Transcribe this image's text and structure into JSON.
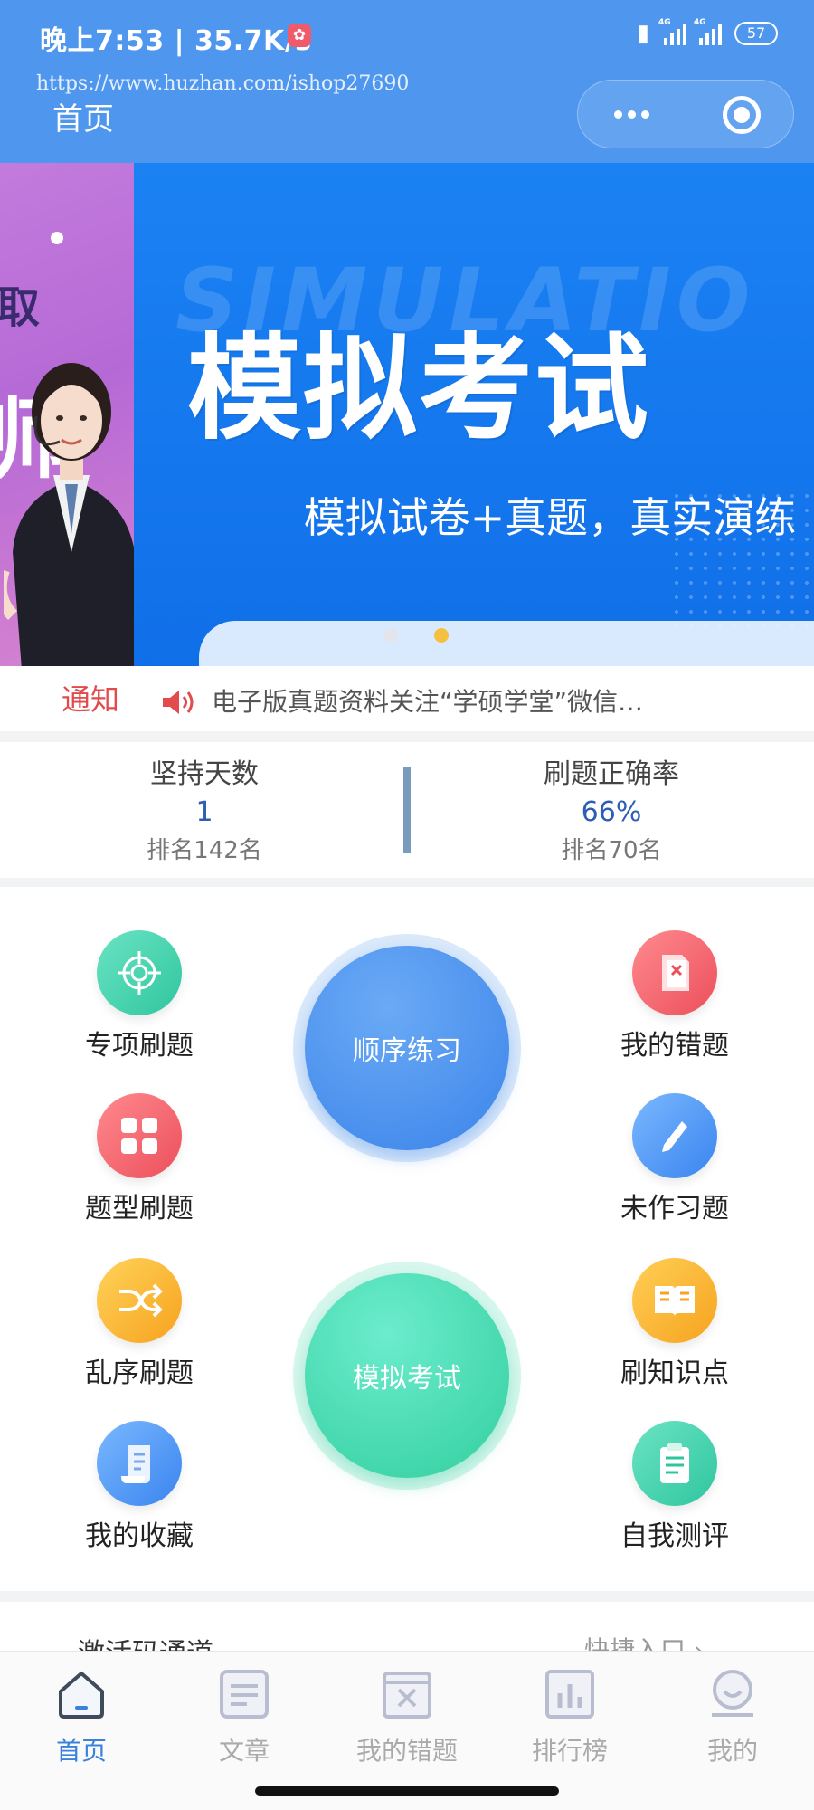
{
  "status_bar": {
    "time": "晚上7:53 | 35.7K/s",
    "network_label": "4G",
    "battery": "57"
  },
  "watermark": "https://www.huzhan.com/ishop27690",
  "page_title": "首页",
  "banner": {
    "prev_slide_text_top": "取",
    "prev_slide_text_bottom": "师",
    "ghost_text": "SIMULATIO",
    "title": "模拟考试",
    "subtitle": "模拟试卷+真题，真实演练"
  },
  "notice": {
    "label": "通知",
    "text": "电子版真题资料关注“学硕学堂”微信…"
  },
  "stats": {
    "left": {
      "title": "坚持天数",
      "value": "1",
      "rank": "排名142名"
    },
    "right": {
      "title": "刷题正确率",
      "value": "66%",
      "rank": "排名70名"
    }
  },
  "grid": {
    "left": [
      {
        "label": "专项刷题",
        "icon": "target-icon"
      },
      {
        "label": "题型刷题",
        "icon": "grid-icon"
      },
      {
        "label": "乱序刷题",
        "icon": "shuffle-icon"
      },
      {
        "label": "我的收藏",
        "icon": "document-icon"
      }
    ],
    "right": [
      {
        "label": "我的错题",
        "icon": "wrong-doc-icon"
      },
      {
        "label": "未作习题",
        "icon": "pencil-icon"
      },
      {
        "label": "刷知识点",
        "icon": "book-icon"
      },
      {
        "label": "自我测评",
        "icon": "clipboard-icon"
      }
    ],
    "center_top": "顺序练习",
    "center_bottom": "模拟考试"
  },
  "quick": {
    "left": "激活码通道",
    "right": "快捷入口 ›"
  },
  "tabbar": [
    {
      "label": "首页",
      "icon": "home-icon",
      "active": true
    },
    {
      "label": "文章",
      "icon": "article-icon",
      "active": false
    },
    {
      "label": "我的错题",
      "icon": "wrong-icon",
      "active": false
    },
    {
      "label": "排行榜",
      "icon": "ranking-icon",
      "active": false
    },
    {
      "label": "我的",
      "icon": "profile-icon",
      "active": false
    }
  ],
  "colors": {
    "header": "#4f97ee",
    "accent_blue": "#3c82dc",
    "notice_red": "#e24b4b",
    "stat_value": "#2d5db5"
  }
}
